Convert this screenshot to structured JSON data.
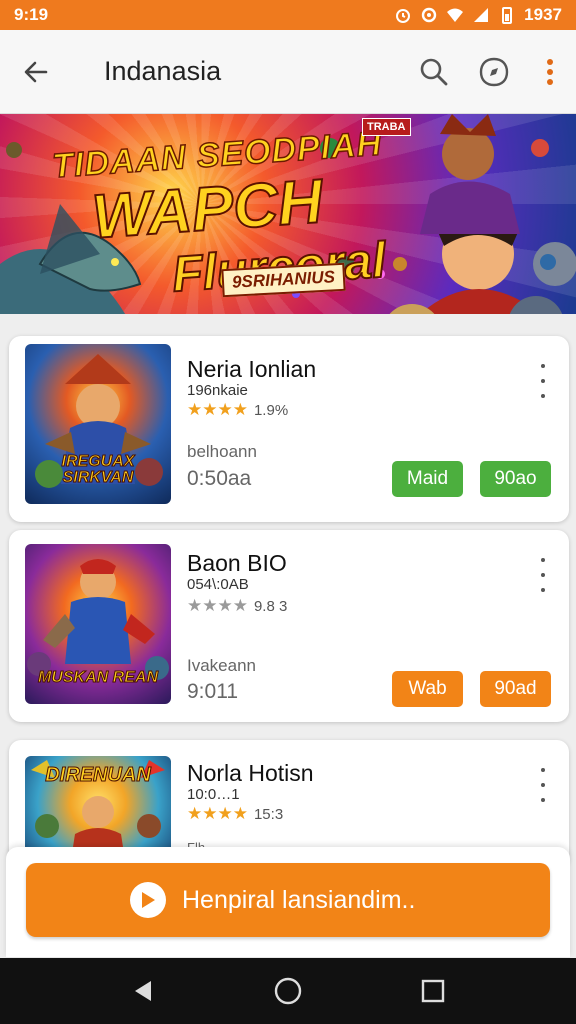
{
  "status_bar": {
    "time": "9:19",
    "clock_right": "1937"
  },
  "app_bar": {
    "title": "Indanasia"
  },
  "banner": {
    "line1": "TIDAAN SEODPIAH",
    "line2": "WAPCH",
    "line3": "Flurcoral",
    "line4": "9SRIHANIUS",
    "badge": "TRABA"
  },
  "apps": [
    {
      "name": "Neria Ionlian",
      "subtitle": "196nkaie",
      "stars": "★★★★",
      "rating_text": "1.9%",
      "category": "belhoann",
      "size": "0:50aa",
      "thumb_title": "",
      "thumb_label": "IREGUAX SIRKVAN",
      "btn1": "Maid",
      "btn2": "90ao",
      "accent": "#4caf3e"
    },
    {
      "name": "Baon BIO",
      "subtitle": "054\\:0AB",
      "stars": "★★★★",
      "rating_text": "9.8 3",
      "category": "Ivakeann",
      "size": "9:011",
      "thumb_title": "",
      "thumb_label": "MUSKAN REAN",
      "btn1": "Wab",
      "btn2": "90ad",
      "accent": "#f28417"
    },
    {
      "name": "Norla Hotisn",
      "subtitle": "10:0…1",
      "stars": "★★★★",
      "rating_text": "15:3",
      "category": "Flh",
      "size": "",
      "thumb_title": "DIRENUAN",
      "thumb_label": "",
      "btn1": "",
      "btn2": "",
      "accent": "#f28417"
    }
  ],
  "cta": {
    "label": "Henpiral lansiandim.."
  },
  "colors": {
    "status_bar": "#ef7a1e",
    "green": "#4caf3e",
    "orange": "#f28417",
    "star": "#f1a01d"
  },
  "icons": {
    "back": "arrow-left-icon",
    "search": "search-icon",
    "compass": "compass-icon",
    "more": "more-vert-icon",
    "play": "play-icon",
    "nav_back": "triangle-back-icon",
    "nav_home": "circle-home-icon",
    "nav_recent": "square-recent-icon"
  }
}
